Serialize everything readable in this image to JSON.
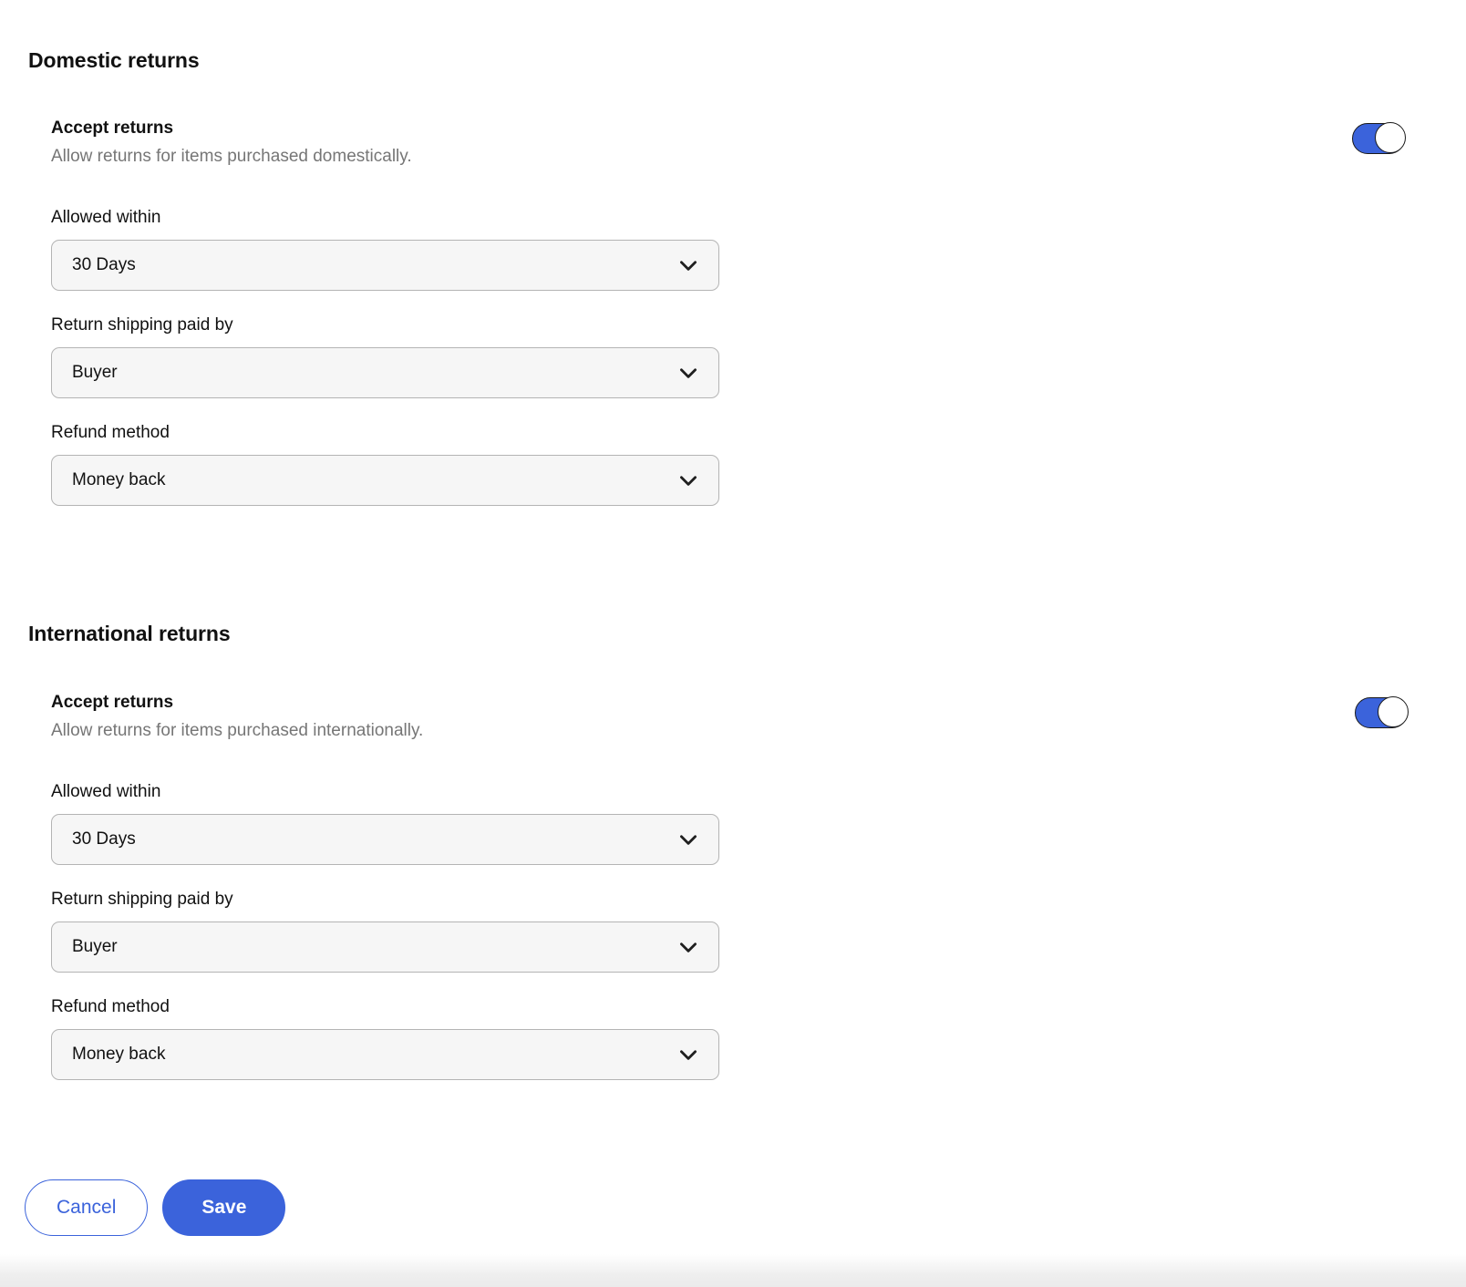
{
  "sections": [
    {
      "title": "Domestic returns",
      "accept": {
        "title": "Accept returns",
        "description": "Allow returns for items purchased domestically.",
        "toggle_state": "on",
        "toggle_icon": "toggle-on-icon"
      },
      "fields": [
        {
          "label": "Allowed within",
          "value": "30 Days",
          "icon": "chevron-down-icon"
        },
        {
          "label": "Return shipping paid by",
          "value": "Buyer",
          "icon": "chevron-down-icon"
        },
        {
          "label": "Refund method",
          "value": "Money back",
          "icon": "chevron-down-icon"
        }
      ]
    },
    {
      "title": "International returns",
      "accept": {
        "title": "Accept returns",
        "description": "Allow returns for items purchased internationally.",
        "toggle_state": "on",
        "toggle_icon": "toggle-on-icon"
      },
      "fields": [
        {
          "label": "Allowed within",
          "value": "30 Days",
          "icon": "chevron-down-icon"
        },
        {
          "label": "Return shipping paid by",
          "value": "Buyer",
          "icon": "chevron-down-icon"
        },
        {
          "label": "Refund method",
          "value": "Money back",
          "icon": "chevron-down-icon"
        }
      ]
    }
  ],
  "footer": {
    "cancel_label": "Cancel",
    "save_label": "Save"
  },
  "colors": {
    "accent_blue": "#3b63db",
    "field_background": "#f6f6f6",
    "field_border": "#b4b4b4",
    "muted_text": "#767676",
    "primary_text": "#111111"
  }
}
